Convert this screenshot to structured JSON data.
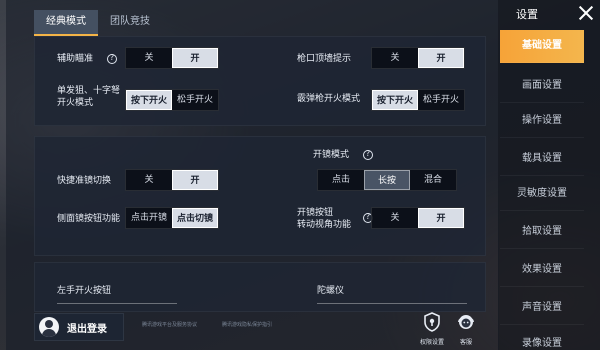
{
  "top_tabs": [
    "经典模式",
    "团队竞技"
  ],
  "panel1": {
    "aim_assist_label": "辅助瞄准",
    "aim_assist_options": [
      "关",
      "开"
    ],
    "wall_hint_label": "枪口顶墙提示",
    "wall_hint_options": [
      "关",
      "开"
    ],
    "sniper_fire_label": "单发狙、十字弩开火模式",
    "sniper_fire_options": [
      "按下开火",
      "松手开火"
    ],
    "shotgun_fire_label": "霰弹枪开火模式",
    "shotgun_fire_options": [
      "按下开火",
      "松手开火"
    ]
  },
  "panel2": {
    "quick_scope_label": "快捷准镜切换",
    "quick_scope_options": [
      "关",
      "开"
    ],
    "scope_mode_label": "开镜模式",
    "scope_mode_options": [
      "点击",
      "长按",
      "混合"
    ],
    "side_scope_label": "侧面镜按钮功能",
    "side_scope_options": [
      "点击开镜",
      "点击切镜"
    ],
    "scope_turn_label_line1": "开镜按钮",
    "scope_turn_label_line2": "转动视角功能",
    "scope_turn_options": [
      "关",
      "开"
    ]
  },
  "panel3": {
    "left_fire_label": "左手开火按钮",
    "gyro_label": "陀螺仪"
  },
  "logout_label": "退出登录",
  "footnotes": [
    "腾讯游戏平台及服务协议",
    "腾讯游戏隐私保护指引"
  ],
  "bottom_buttons": [
    "权限设置",
    "客服"
  ],
  "sidebar": {
    "title": "设置",
    "items": [
      "基础设置",
      "画面设置",
      "操作设置",
      "载具设置",
      "灵敏度设置",
      "拾取设置",
      "效果设置",
      "声音设置",
      "录像设置"
    ],
    "active_index": 0
  },
  "colors": {
    "accent": "#f6a338",
    "selected": "#d8dde6"
  }
}
